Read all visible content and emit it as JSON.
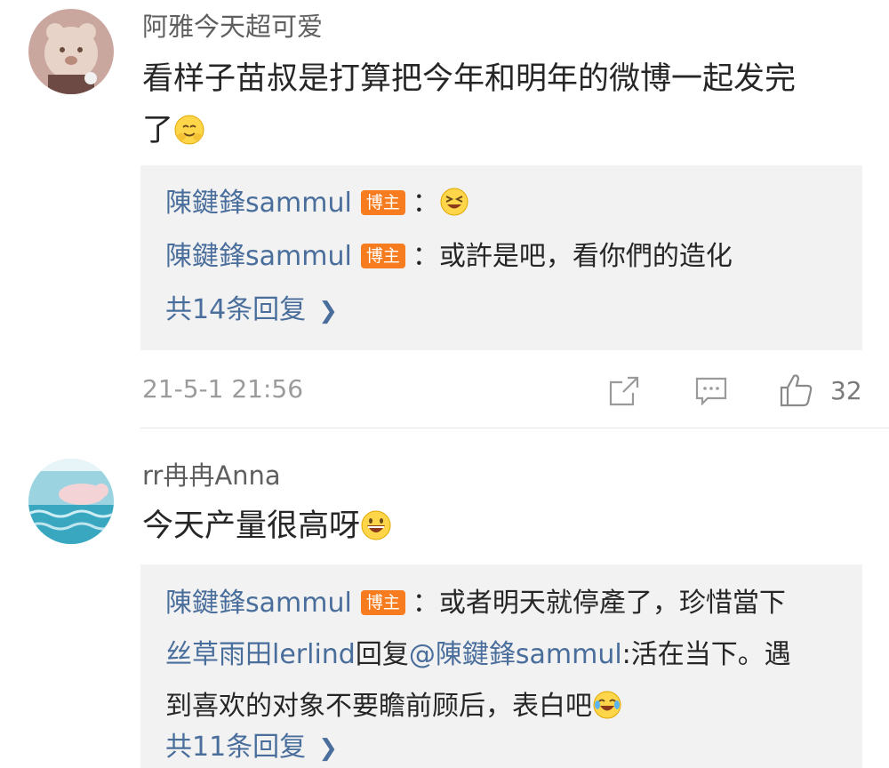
{
  "comments": [
    {
      "username": "阿雅今天超可爱",
      "text_line1": "看样子苗叔是打算把今年和明年的微博一起发完",
      "text_line2": "了",
      "emoji": "hug-emoji",
      "replies": [
        {
          "name": "陳鍵鋒sammul",
          "badge": "博主",
          "sep": "：",
          "emoji": "laughing-squint-emoji"
        },
        {
          "name": "陳鍵鋒sammul",
          "badge": "博主",
          "sep": "：",
          "text": "或許是吧，看你們的造化"
        }
      ],
      "more_replies": "共14条回复",
      "time": "21-5-1 21:56",
      "likes": "32"
    },
    {
      "username": "rr冉冉Anna",
      "text": "今天产量很高呀",
      "emoji": "grinning-emoji",
      "replies": [
        {
          "name": "陳鍵鋒sammul",
          "badge": "博主",
          "sep": "：",
          "text": "或者明天就停產了，珍惜當下"
        },
        {
          "name": "丝草雨田lerlind",
          "reply_word": "回复",
          "mention": "@陳鍵鋒sammul",
          "text_line1": ":活在当下。遇",
          "text_line2": "到喜欢的对象不要瞻前顾后，表白吧",
          "emoji": "tears-of-joy-emoji"
        }
      ],
      "more_replies": "共11条回复"
    }
  ],
  "colors": {
    "link_blue": "#4a6e9c",
    "badge_orange": "#f77c1f",
    "reply_bg": "#f2f2f2",
    "meta_gray": "#9b9b9b"
  },
  "icons": {
    "share": "share-icon",
    "comment": "comment-icon",
    "like": "thumbs-up-icon",
    "more": "chevron-right-icon"
  }
}
